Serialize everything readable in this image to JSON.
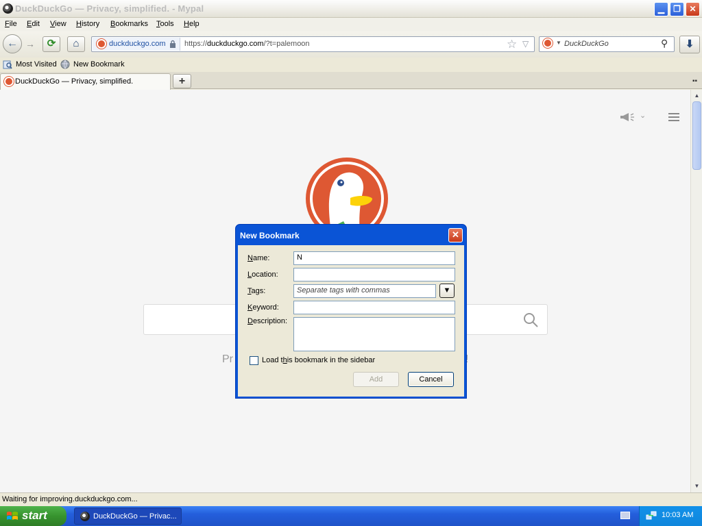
{
  "window": {
    "title": "DuckDuckGo — Privacy, simplified. - Mypal",
    "min_glyph": "▁",
    "max_glyph": "❐",
    "close_glyph": "✕"
  },
  "menu": [
    {
      "label_u": "F",
      "label_rest": "ile"
    },
    {
      "label_u": "E",
      "label_rest": "dit"
    },
    {
      "label_u": "V",
      "label_rest": "iew"
    },
    {
      "label_u": "H",
      "label_rest": "istory"
    },
    {
      "label_u": "B",
      "label_rest": "ookmarks"
    },
    {
      "label_u": "T",
      "label_rest": "ools"
    },
    {
      "label_u": "H",
      "label_rest": "elp"
    }
  ],
  "nav": {
    "back_glyph": "←",
    "forward_glyph": "→",
    "reload_glyph": "⟳",
    "home_glyph": "⌂",
    "identity_domain": "duckduckgo.com",
    "url_scheme": "https://",
    "url_host": "duckduckgo.com",
    "url_rest": "/?t=palemoon",
    "star_glyph": "☆",
    "dropmark_glyph": "▽",
    "search_placeholder": "DuckDuckGo",
    "search_glyph": "⚲",
    "download_glyph": "⬇"
  },
  "bookmarks_bar": {
    "most_visited": "Most Visited",
    "new_bookmark": "New Bookmark"
  },
  "tabs": {
    "active_label": "DuckDuckGo — Privacy, simplified.",
    "new_tab_glyph": "+",
    "list_glyph": "▪▪"
  },
  "content": {
    "tagline_left": "Pr",
    "tagline_right": "!",
    "chevron_glyph": "⌄"
  },
  "scrollbar": {
    "up_glyph": "▲",
    "down_glyph": "▼"
  },
  "status": {
    "text": "Waiting for improving.duckduckgo.com..."
  },
  "dialog": {
    "title": "New Bookmark",
    "close_glyph": "✕",
    "name_label_u": "N",
    "name_label_rest": "ame:",
    "name_value": "N",
    "location_label_u": "L",
    "location_label_rest": "ocation:",
    "location_value": "",
    "tags_label_u": "T",
    "tags_label_rest": "ags:",
    "tags_placeholder": "Separate tags with commas",
    "tags_dropdown_glyph": "▼",
    "keyword_label_u": "K",
    "keyword_label_rest": "eyword:",
    "description_label_u": "D",
    "description_label_rest": "escription:",
    "sidebar_check_pre": "Load t",
    "sidebar_check_u": "h",
    "sidebar_check_post": "is bookmark in the sidebar",
    "sidebar_checked": false,
    "add_label": "Add",
    "cancel_label": "Cancel"
  },
  "taskbar": {
    "start_label": "start",
    "task_label": "DuckDuckGo — Privac...",
    "clock": "10:03 AM"
  },
  "colors": {
    "ddg_orange": "#de5833",
    "xp_blue": "#0a54d6",
    "start_green": "#37932e"
  }
}
